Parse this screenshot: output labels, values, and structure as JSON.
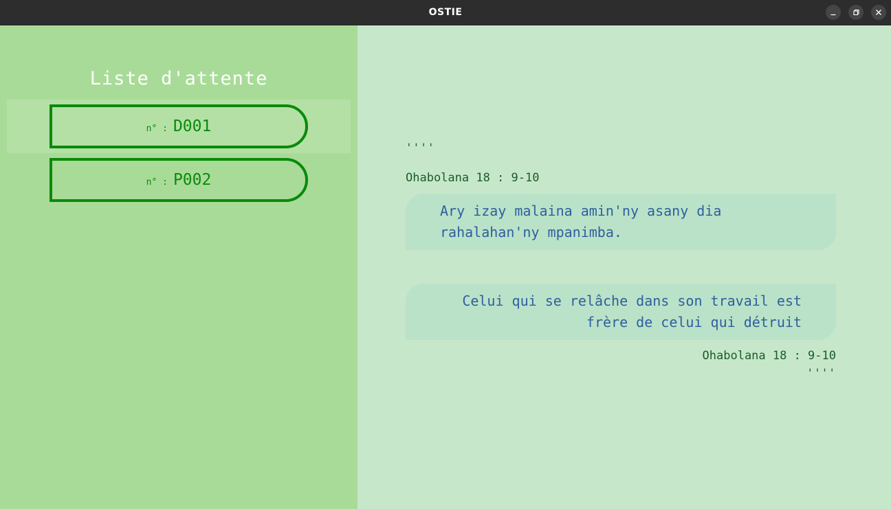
{
  "window": {
    "title": "OSTIE",
    "controls": {
      "minimize_icon": "minimize-icon",
      "maximize_icon": "maximize-icon",
      "close_icon": "close-icon"
    }
  },
  "sidebar": {
    "title": "Liste d'attente",
    "tickets": [
      {
        "prefix": "n° :",
        "code": "D001",
        "selected": true
      },
      {
        "prefix": "n° :",
        "code": "P002",
        "selected": false
      }
    ]
  },
  "main": {
    "quotes": [
      {
        "ticks": "''''",
        "reference": "Ohabolana 18 : 9-10",
        "line1": "Ary izay malaina amin'ny asany dia",
        "line2": "rahalahan'ny mpanimba."
      },
      {
        "line1": "Celui qui se relâche dans son travail est",
        "line2": "frère de celui qui détruit",
        "reference": "Ohabolana 18 : 9-10",
        "ticks": "''''"
      }
    ]
  },
  "colors": {
    "sidebar_bg": "#a8db98",
    "main_bg": "#c7e7ca",
    "ticket_border": "#0a8a0a",
    "quote_text": "#2e5f9e",
    "quote_bg": "#bae2c8"
  }
}
